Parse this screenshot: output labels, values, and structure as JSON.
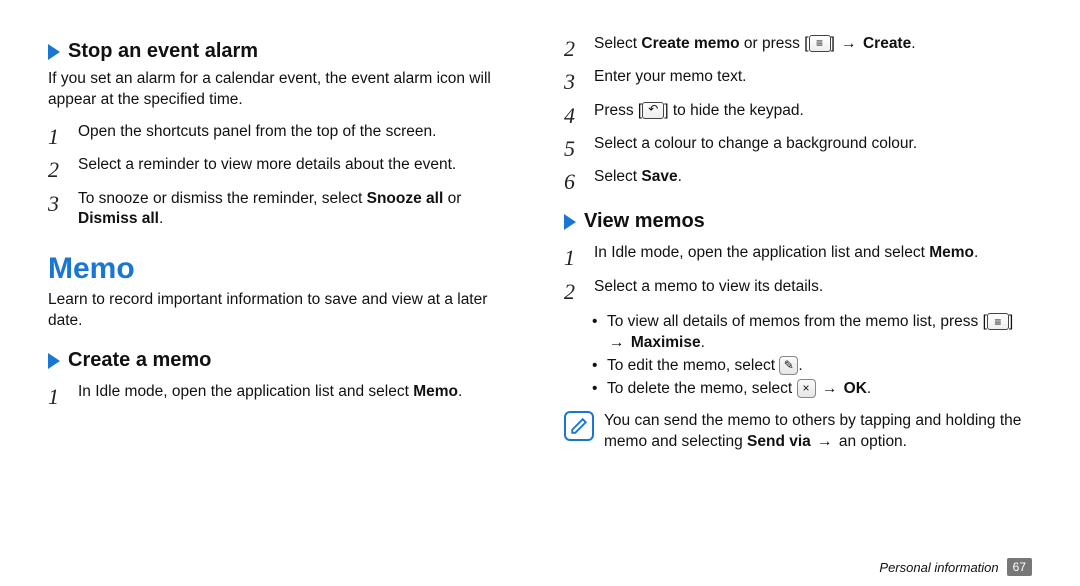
{
  "left": {
    "sub1_title": "Stop an event alarm",
    "sub1_intro": "If you set an alarm for a calendar event, the event alarm icon will appear at the specified time.",
    "sub1_steps": [
      "Open the shortcuts panel from the top of the screen.",
      "Select a reminder to view more details about the event.",
      [
        "To snooze or dismiss the reminder, select ",
        {
          "b": "Snooze all"
        },
        " or ",
        {
          "b": "Dismiss all"
        },
        "."
      ]
    ],
    "memo_title": "Memo",
    "memo_intro": "Learn to record important information to save and view at a later date.",
    "sub2_title": "Create a memo",
    "sub2_steps": [
      [
        "In Idle mode, open the application list and select ",
        {
          "b": "Memo"
        },
        "."
      ]
    ]
  },
  "right": {
    "cont_steps": [
      {
        "n": "2",
        "parts": [
          "Select ",
          {
            "b": "Create memo"
          },
          " or press [",
          {
            "icon": "menu"
          },
          "] ",
          {
            "arrow": "→"
          },
          " ",
          {
            "b": "Create"
          },
          "."
        ]
      },
      {
        "n": "3",
        "parts": [
          "Enter your memo text."
        ]
      },
      {
        "n": "4",
        "parts": [
          "Press [",
          {
            "icon": "back"
          },
          "] to hide the keypad."
        ]
      },
      {
        "n": "5",
        "parts": [
          "Select a colour to change a background colour."
        ]
      },
      {
        "n": "6",
        "parts": [
          "Select ",
          {
            "b": "Save"
          },
          "."
        ]
      }
    ],
    "sub3_title": "View memos",
    "sub3_steps": [
      {
        "n": "1",
        "parts": [
          "In Idle mode, open the application list and select ",
          {
            "b": "Memo"
          },
          "."
        ]
      },
      {
        "n": "2",
        "parts": [
          "Select a memo to view its details."
        ]
      }
    ],
    "bullets": [
      [
        "To view all details of memos from the memo list, press [",
        {
          "icon": "menu"
        },
        "] ",
        {
          "arrow": "→"
        },
        " ",
        {
          "b": "Maximise"
        },
        "."
      ],
      [
        "To edit the memo, select ",
        {
          "round": "✎"
        },
        "."
      ],
      [
        "To delete the memo, select ",
        {
          "round": "×"
        },
        " ",
        {
          "arrow": "→"
        },
        " ",
        {
          "b": "OK"
        },
        "."
      ]
    ],
    "note": [
      "You can send the memo to others by tapping and holding the memo and selecting ",
      {
        "b": "Send via"
      },
      " ",
      {
        "arrow": "→"
      },
      " an option."
    ]
  },
  "footer_label": "Personal information",
  "page_number": "67",
  "icons": {
    "menu": "≡",
    "back": "↶"
  }
}
